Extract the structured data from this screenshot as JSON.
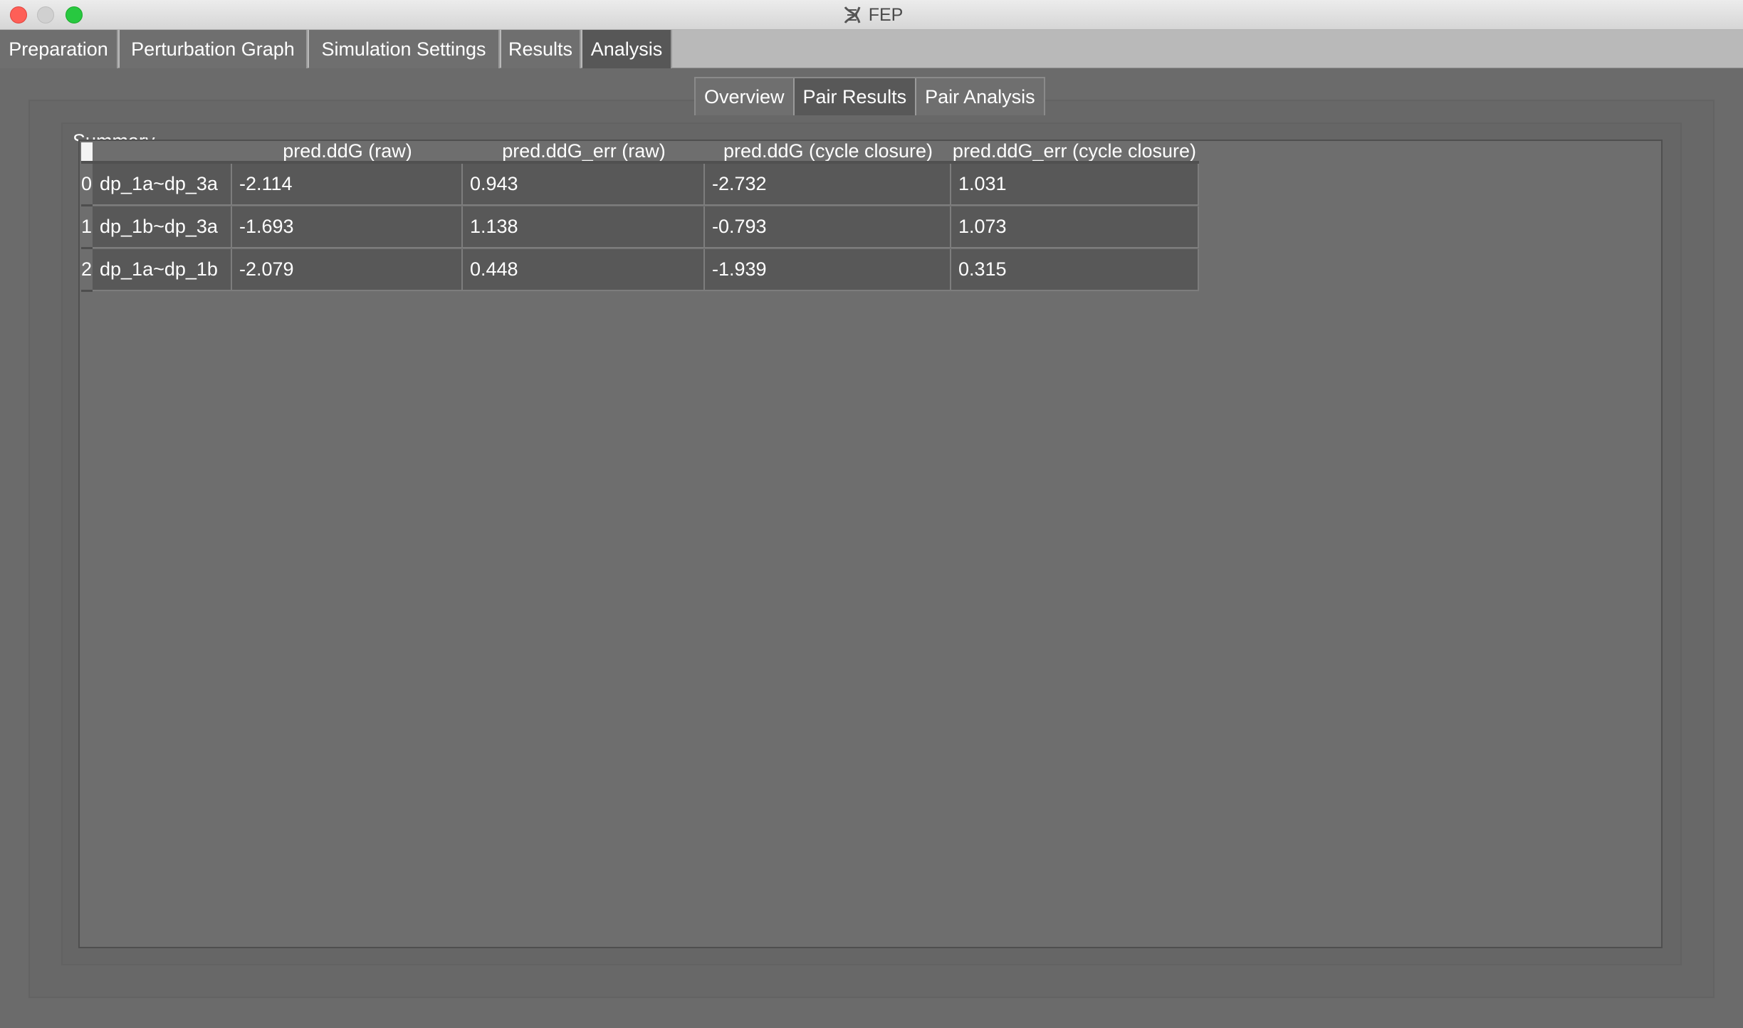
{
  "window": {
    "title": "FEP",
    "icon": "dna-helix-icon"
  },
  "main_tabs": [
    {
      "label": "Preparation",
      "active": false
    },
    {
      "label": "Perturbation Graph",
      "active": false
    },
    {
      "label": "Simulation Settings",
      "active": false
    },
    {
      "label": "Results",
      "active": false
    },
    {
      "label": "Analysis",
      "active": true
    }
  ],
  "sub_tabs": [
    {
      "label": "Overview",
      "active": false
    },
    {
      "label": "Pair Results",
      "active": true
    },
    {
      "label": "Pair Analysis",
      "active": false
    }
  ],
  "summary": {
    "label": "Summary",
    "columns": [
      "pred.ddG (raw)",
      "pred.ddG_err (raw)",
      "pred.ddG (cycle closure)",
      "pred.ddG_err (cycle closure)"
    ],
    "rows": [
      {
        "index": "0",
        "pair": "dp_1a~dp_3a",
        "values": [
          "-2.114",
          "0.943",
          "-2.732",
          "1.031"
        ]
      },
      {
        "index": "1",
        "pair": "dp_1b~dp_3a",
        "values": [
          "-1.693",
          "1.138",
          "-0.793",
          "1.073"
        ]
      },
      {
        "index": "2",
        "pair": "dp_1a~dp_1b",
        "values": [
          "-2.079",
          "0.448",
          "-1.939",
          "0.315"
        ]
      }
    ]
  },
  "colors": {
    "close": "#fe5f57",
    "minimize": "#d0d0d0",
    "maximize": "#28c840",
    "tab_bar": "#b9b9b9",
    "background": "#6b6b6b",
    "cell": "#585858"
  }
}
